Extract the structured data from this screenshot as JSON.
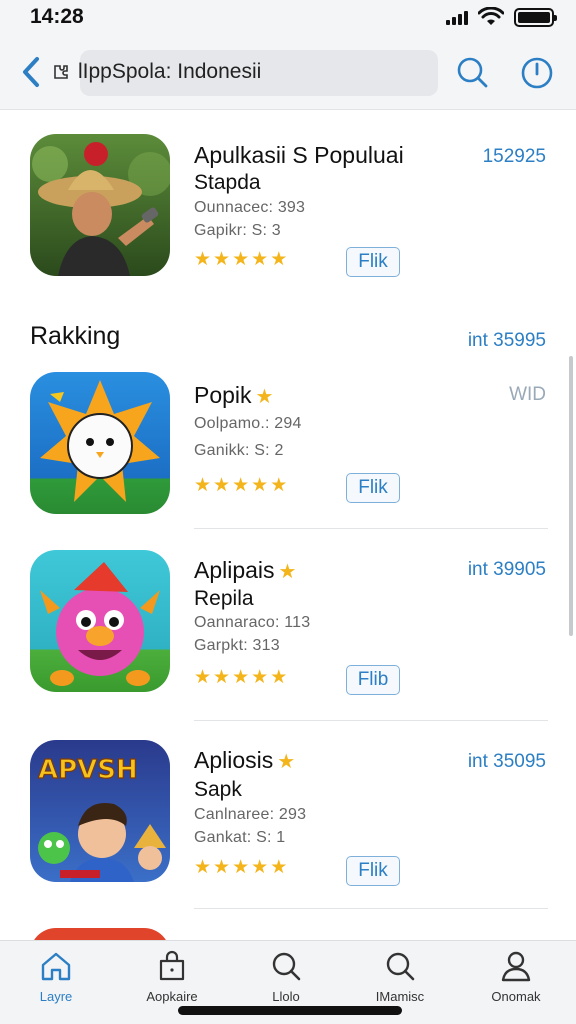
{
  "status_bar": {
    "time": "14:28"
  },
  "header": {
    "search_label": "lIppSpola: Indonesii"
  },
  "featured": {
    "name": "Apulkasii S Populuai",
    "subtitle": "Stapda",
    "meta_1": "Ounnacec: 393",
    "meta_2": "Gapikr: S: 3",
    "price": "152925",
    "rating": 4.5,
    "get_label": "Flik"
  },
  "section": {
    "title": "Rakking",
    "link": "int 35995"
  },
  "apps": [
    {
      "name": "Popik",
      "subtitle": "",
      "meta_1": "Oolpamo.: 294",
      "meta_2": "Ganikk: S: 2",
      "price": "WID",
      "rating": 4.5,
      "get_label": "Flik"
    },
    {
      "name": "Aplipais",
      "subtitle": "Repila",
      "meta_1": "Oannaraco: 113",
      "meta_2": "Garpkt: 313",
      "price": "int 39905",
      "rating": 4.5,
      "get_label": "Flib"
    },
    {
      "name": "Apliosis",
      "subtitle": "Sapk",
      "meta_1": "Canlnaree: 293",
      "meta_2": "Gankat: S: 1",
      "price": "int 35095",
      "rating": 4.5,
      "get_label": "Flik"
    }
  ],
  "tab_bar": {
    "tabs": [
      {
        "label": "Layre",
        "icon": "home-icon"
      },
      {
        "label": "Aopkaire",
        "icon": "shopping-bag-icon"
      },
      {
        "label": "Llolo",
        "icon": "search-icon"
      },
      {
        "label": "IMamisc",
        "icon": "search-icon"
      },
      {
        "label": "Onomak",
        "icon": "person-icon"
      }
    ]
  },
  "colors": {
    "accent": "#2c7fc4",
    "star": "#f3b51b"
  },
  "icons": {
    "header": [
      "back-chevron-icon",
      "puzzle-icon",
      "search-icon",
      "power-icon"
    ]
  }
}
